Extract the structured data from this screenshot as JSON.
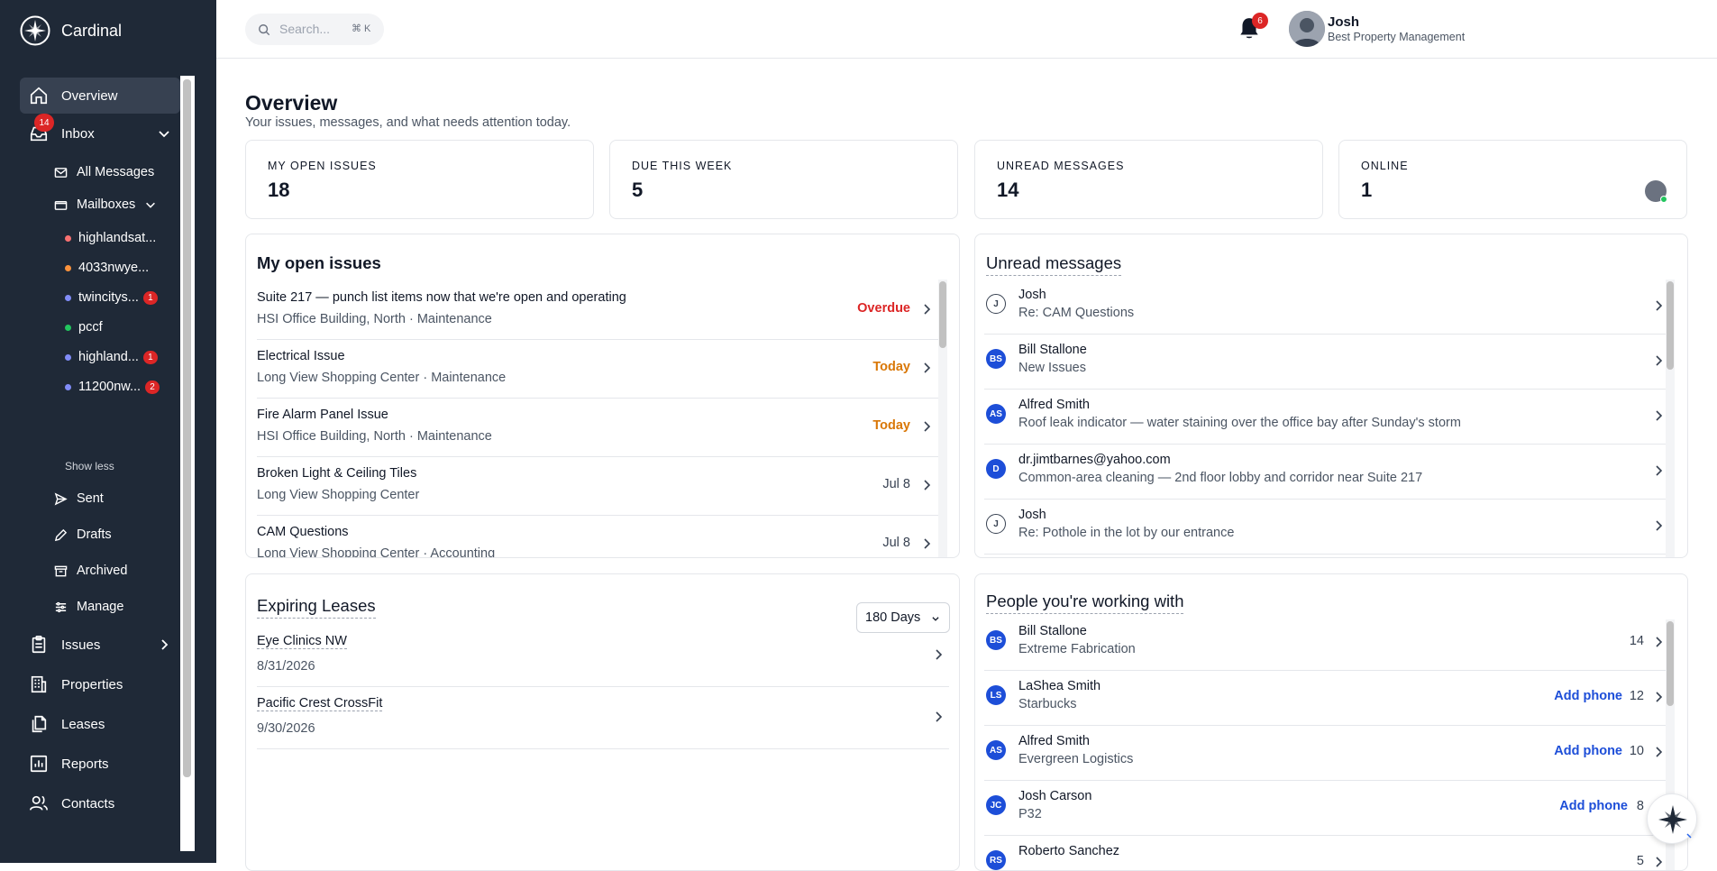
{
  "app": {
    "name": "Cardinal"
  },
  "search": {
    "placeholder": "Search...",
    "shortcut": "⌘ K"
  },
  "notifications": {
    "count": "6"
  },
  "user": {
    "name": "Josh",
    "org": "Best Property Management"
  },
  "sidebar": {
    "overview": "Overview",
    "inbox": {
      "label": "Inbox",
      "badge": "14"
    },
    "all_messages": "All Messages",
    "mailboxes": "Mailboxes",
    "mailbox_list": [
      {
        "label": "highlandsat...",
        "color": "#f87171",
        "count": ""
      },
      {
        "label": "4033nwye...",
        "color": "#fb923c",
        "count": ""
      },
      {
        "label": "twincitys...",
        "color": "#818cf8",
        "count": "1"
      },
      {
        "label": "pccf",
        "color": "#22c55e",
        "count": ""
      },
      {
        "label": "highland...",
        "color": "#818cf8",
        "count": "1"
      },
      {
        "label": "11200nw...",
        "color": "#818cf8",
        "count": "2"
      }
    ],
    "show_less": "Show less",
    "sent": "Sent",
    "drafts": "Drafts",
    "archived": "Archived",
    "manage": "Manage",
    "issues": "Issues",
    "properties": "Properties",
    "leases": "Leases",
    "reports": "Reports",
    "contacts": "Contacts"
  },
  "page": {
    "title": "Overview",
    "subtitle": "Your issues, messages, and what needs attention today."
  },
  "stats": [
    {
      "label": "MY OPEN ISSUES",
      "value": "18"
    },
    {
      "label": "DUE THIS WEEK",
      "value": "5"
    },
    {
      "label": "UNREAD MESSAGES",
      "value": "14"
    },
    {
      "label": "ONLINE",
      "value": "1"
    }
  ],
  "open_issues": {
    "title": "My open issues",
    "items": [
      {
        "title": "Suite 217 — punch list items now that we're open and operating",
        "sub": "HSI Office Building, North · Maintenance",
        "status": "Overdue",
        "status_color": "#dc2626"
      },
      {
        "title": "Electrical Issue",
        "sub": "Long View Shopping Center · Maintenance",
        "status": "Today",
        "status_color": "#d97706"
      },
      {
        "title": "Fire Alarm Panel Issue",
        "sub": "HSI Office Building, North · Maintenance",
        "status": "Today",
        "status_color": "#d97706"
      },
      {
        "title": "Broken Light & Ceiling Tiles",
        "sub": "Long View Shopping Center",
        "status": "Jul 8",
        "status_color": "#374151"
      },
      {
        "title": "CAM Questions",
        "sub": "Long View Shopping Center · Accounting",
        "status": "Jul 8",
        "status_color": "#374151"
      }
    ]
  },
  "unread_messages": {
    "title": "Unread messages",
    "items": [
      {
        "initials": "J",
        "style": "outline",
        "from": "Josh",
        "subject": "Re: CAM Questions"
      },
      {
        "initials": "BS",
        "style": "blue",
        "from": "Bill Stallone",
        "subject": "New Issues"
      },
      {
        "initials": "AS",
        "style": "blue",
        "from": "Alfred Smith",
        "subject": "Roof leak indicator — water staining over the office bay after Sunday's storm"
      },
      {
        "initials": "D",
        "style": "blue",
        "from": "dr.jimtbarnes@yahoo.com",
        "subject": "Common-area cleaning — 2nd floor lobby and corridor near Suite 217"
      },
      {
        "initials": "J",
        "style": "outline",
        "from": "Josh",
        "subject": "Re: Pothole in the lot by our entrance"
      }
    ]
  },
  "expiring_leases": {
    "title": "Expiring Leases",
    "filter": "180 Days",
    "items": [
      {
        "tenant": "Eye Clinics NW",
        "date": "8/31/2026"
      },
      {
        "tenant": "Pacific Crest CrossFit",
        "date": "9/30/2026"
      }
    ]
  },
  "people": {
    "title": "People you're working with",
    "add_phone": "Add phone",
    "items": [
      {
        "initials": "BS",
        "name": "Bill Stallone",
        "org": "Extreme Fabrication",
        "count": "14",
        "add_phone": false
      },
      {
        "initials": "LS",
        "name": "LaShea Smith",
        "org": "Starbucks",
        "count": "12",
        "add_phone": true
      },
      {
        "initials": "AS",
        "name": "Alfred Smith",
        "org": "Evergreen Logistics",
        "count": "10",
        "add_phone": true
      },
      {
        "initials": "JC",
        "name": "Josh Carson",
        "org": "P32",
        "count": "8",
        "add_phone": true
      },
      {
        "initials": "RS",
        "name": "Roberto Sanchez",
        "org": "",
        "count": "5",
        "add_phone": false
      }
    ]
  },
  "colors": {
    "sidebar": "#1f2937",
    "accent": "#1d4ed8",
    "danger": "#dc2626",
    "warning": "#d97706"
  }
}
